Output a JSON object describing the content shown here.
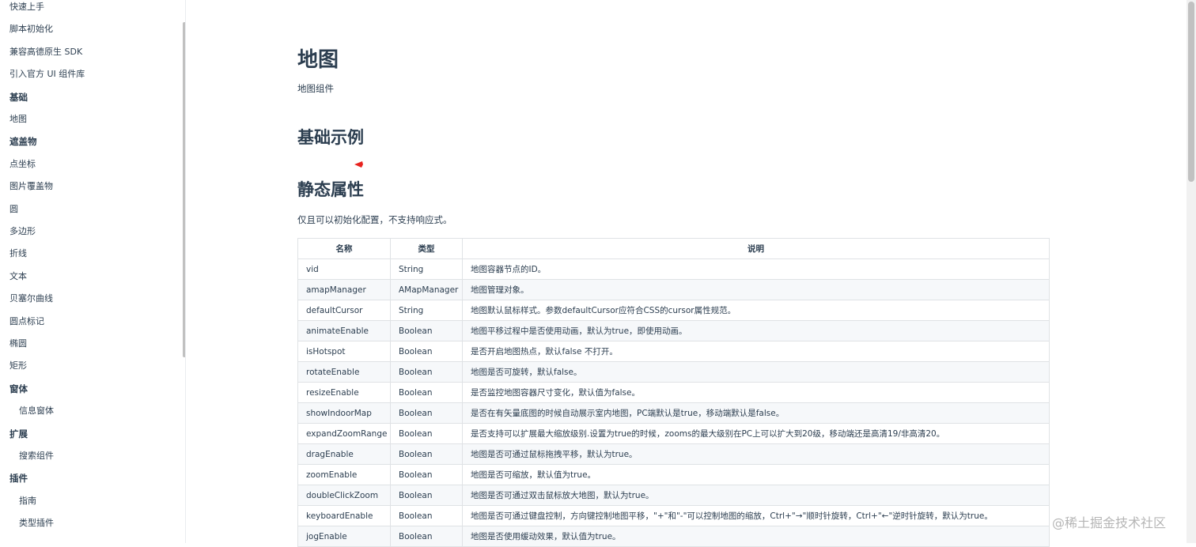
{
  "sidebar": {
    "items": [
      {
        "label": "快速上手",
        "kind": "item"
      },
      {
        "label": "脚本初始化",
        "kind": "item"
      },
      {
        "label": "兼容高德原生 SDK",
        "kind": "item"
      },
      {
        "label": "引入官方 UI 组件库",
        "kind": "item"
      },
      {
        "label": "基础",
        "kind": "group"
      },
      {
        "label": "地图",
        "kind": "item"
      },
      {
        "label": "遮盖物",
        "kind": "group"
      },
      {
        "label": "点坐标",
        "kind": "item"
      },
      {
        "label": "图片覆盖物",
        "kind": "item"
      },
      {
        "label": "圆",
        "kind": "item"
      },
      {
        "label": "多边形",
        "kind": "item"
      },
      {
        "label": "折线",
        "kind": "item"
      },
      {
        "label": "文本",
        "kind": "item"
      },
      {
        "label": "贝塞尔曲线",
        "kind": "item"
      },
      {
        "label": "圆点标记",
        "kind": "item"
      },
      {
        "label": "椭圆",
        "kind": "item"
      },
      {
        "label": "矩形",
        "kind": "item"
      },
      {
        "label": "窗体",
        "kind": "group"
      },
      {
        "label": "信息窗体",
        "kind": "sub"
      },
      {
        "label": "扩展",
        "kind": "group"
      },
      {
        "label": "搜索组件",
        "kind": "sub"
      },
      {
        "label": "插件",
        "kind": "group"
      },
      {
        "label": "指南",
        "kind": "sub"
      },
      {
        "label": "类型插件",
        "kind": "sub"
      },
      {
        "label": "",
        "kind": "sub"
      }
    ]
  },
  "main": {
    "title": "地图",
    "description": "地图组件",
    "section_basic": "基础示例",
    "section_static": "静态属性",
    "section_static_desc": "仅且可以初始化配置，不支持响应式。",
    "table": {
      "headers": [
        "名称",
        "类型",
        "说明"
      ],
      "rows": [
        [
          "vid",
          "String",
          "地图容器节点的ID。"
        ],
        [
          "amapManager",
          "AMapManager",
          "地图管理对象。"
        ],
        [
          "defaultCursor",
          "String",
          "地图默认鼠标样式。参数defaultCursor应符合CSS的cursor属性规范。"
        ],
        [
          "animateEnable",
          "Boolean",
          "地图平移过程中是否使用动画，默认为true，即使用动画。"
        ],
        [
          "isHotspot",
          "Boolean",
          "是否开启地图热点，默认false 不打开。"
        ],
        [
          "rotateEnable",
          "Boolean",
          "地图是否可旋转，默认false。"
        ],
        [
          "resizeEnable",
          "Boolean",
          "是否监控地图容器尺寸变化，默认值为false。"
        ],
        [
          "showIndoorMap",
          "Boolean",
          "是否在有矢量底图的时候自动展示室内地图，PC端默认是true，移动端默认是false。"
        ],
        [
          "expandZoomRange",
          "Boolean",
          "是否支持可以扩展最大缩放级别.设置为true的时候，zooms的最大级别在PC上可以扩大到20级，移动端还是高清19/非高清20。"
        ],
        [
          "dragEnable",
          "Boolean",
          "地图是否可通过鼠标拖拽平移，默认为true。"
        ],
        [
          "zoomEnable",
          "Boolean",
          "地图是否可缩放，默认值为true。"
        ],
        [
          "doubleClickZoom",
          "Boolean",
          "地图是否可通过双击鼠标放大地图，默认为true。"
        ],
        [
          "keyboardEnable",
          "Boolean",
          "地图是否可通过键盘控制，方向键控制地图平移，\"+\"和\"-\"可以控制地图的缩放，Ctrl+\"→\"顺时针旋转，Ctrl+\"←\"逆时针旋转，默认为true。"
        ],
        [
          "jogEnable",
          "Boolean",
          "地图是否使用缓动效果，默认值为true。"
        ]
      ]
    }
  },
  "annotation": {
    "arrow_color": "#e8231f"
  },
  "watermark": "@稀土掘金技术社区",
  "colors": {
    "text": "#2c3e50",
    "border": "#dfe2e5",
    "stripe": "#f6f8fa"
  }
}
